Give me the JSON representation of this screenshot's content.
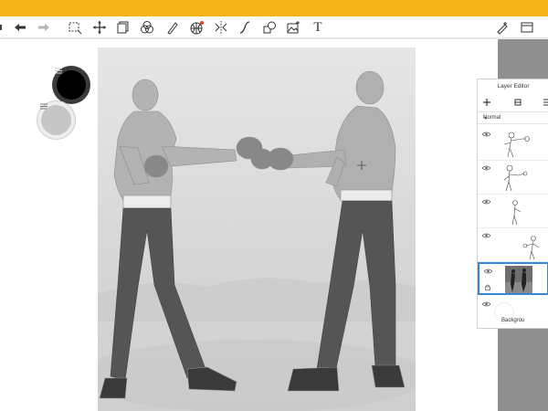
{
  "toolbar": {
    "icons": [
      "undo-icon",
      "redo-icon",
      "select-icon",
      "transform-icon",
      "layers-icon",
      "color-icon",
      "brush-icon",
      "grid-icon",
      "symmetry-icon",
      "curve-icon",
      "shapes-icon",
      "image-icon",
      "text-icon",
      "pen-settings-icon",
      "window-icon"
    ],
    "text_tool_label": "T"
  },
  "layer_editor": {
    "title": "Layer Editor",
    "blend_mode": "Normal",
    "background_label": "Backgrou"
  },
  "colors": {
    "accent_bar": "#f6b419",
    "selection": "#3b86d4"
  }
}
